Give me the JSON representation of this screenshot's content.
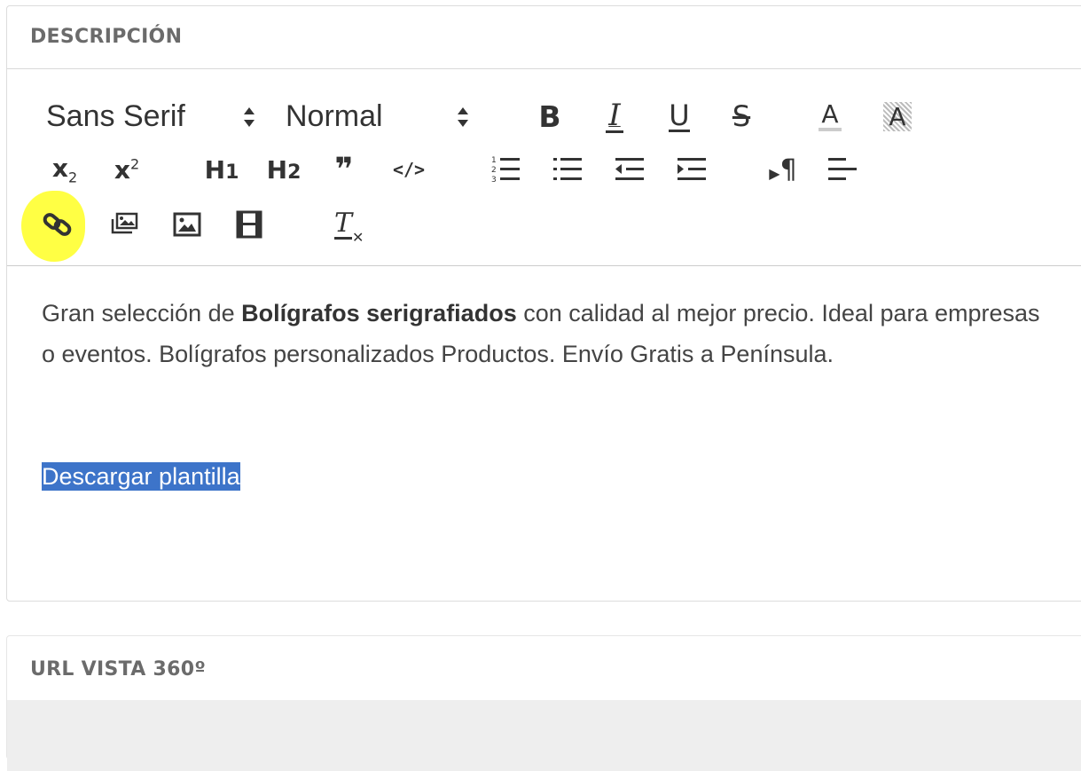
{
  "description_panel": {
    "title": "DESCRIPCIÓN",
    "toolbar": {
      "font_picker": {
        "value": "Sans Serif"
      },
      "size_picker": {
        "value": "Normal"
      },
      "buttons_row1": [
        "bold-icon",
        "italic-icon",
        "underline-icon",
        "strike-icon",
        "text-color-icon",
        "background-color-icon"
      ],
      "labels": {
        "bold": "B",
        "italic": "I",
        "underline": "U",
        "strike": "S",
        "color": "A",
        "background": "A",
        "subscript": "x",
        "subscript_sub": "2",
        "superscript": "x",
        "superscript_sup": "2",
        "h1": "H",
        "h1_num": "1",
        "h2": "H",
        "h2_num": "2",
        "blockquote": "❞",
        "code": "</>",
        "rtl": "¶",
        "clean": "T"
      },
      "highlight_color": "#ffff3a"
    },
    "editor": {
      "paragraph1": {
        "before_bold": "Gran selección de ",
        "bold": "Bolígrafos serigrafiados",
        "after_bold": " con calidad al mejor precio. Ideal para empresas o eventos. Bolígrafos personalizados Productos. Envío Gratis a Península."
      },
      "paragraph2": {
        "selected": "Descargar plantilla"
      },
      "selection_color": "#3d74c9"
    }
  },
  "url_panel": {
    "title": "URL VISTA 360º"
  }
}
